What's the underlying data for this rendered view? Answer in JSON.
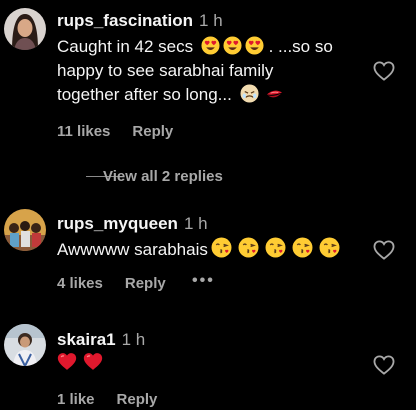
{
  "comments": [
    {
      "username": "rups_fascination",
      "time": "1 h",
      "text_line1": "Caught in 42 secs",
      "text_line1_tail": ". ...so so",
      "text_line2": "happy to see sarabhai family",
      "text_line3": "together after so long...",
      "likes": "11 likes",
      "reply": "Reply",
      "avatar_icon": "woman-portrait-avatar",
      "emojis": [
        "heart-eyes-emoji",
        "heart-eyes-emoji",
        "heart-eyes-emoji",
        "tearful-emoji",
        "lipstick-emoji"
      ]
    },
    {
      "username": "rups_myqueen",
      "time": "1 h",
      "text": "Awwwww sarabhais",
      "likes": "4 likes",
      "reply": "Reply",
      "more": "•••",
      "avatar_icon": "group-photo-avatar",
      "emojis": [
        "kissing-heart-emoji",
        "kissing-heart-emoji",
        "kissing-heart-emoji",
        "kissing-heart-emoji",
        "kissing-heart-emoji"
      ]
    },
    {
      "username": "skaira1",
      "time": "1 h",
      "likes": "1 like",
      "reply": "Reply",
      "avatar_icon": "child-photo-avatar",
      "emojis": [
        "red-heart-emoji",
        "red-heart-emoji"
      ]
    }
  ],
  "view_replies": "View all 2 replies",
  "colors": {
    "background": "#000000",
    "text": "#f5f5f5",
    "muted": "#a8a8a8",
    "emoji_yellow": "#ffcc33",
    "heart_red": "#e0182d"
  }
}
